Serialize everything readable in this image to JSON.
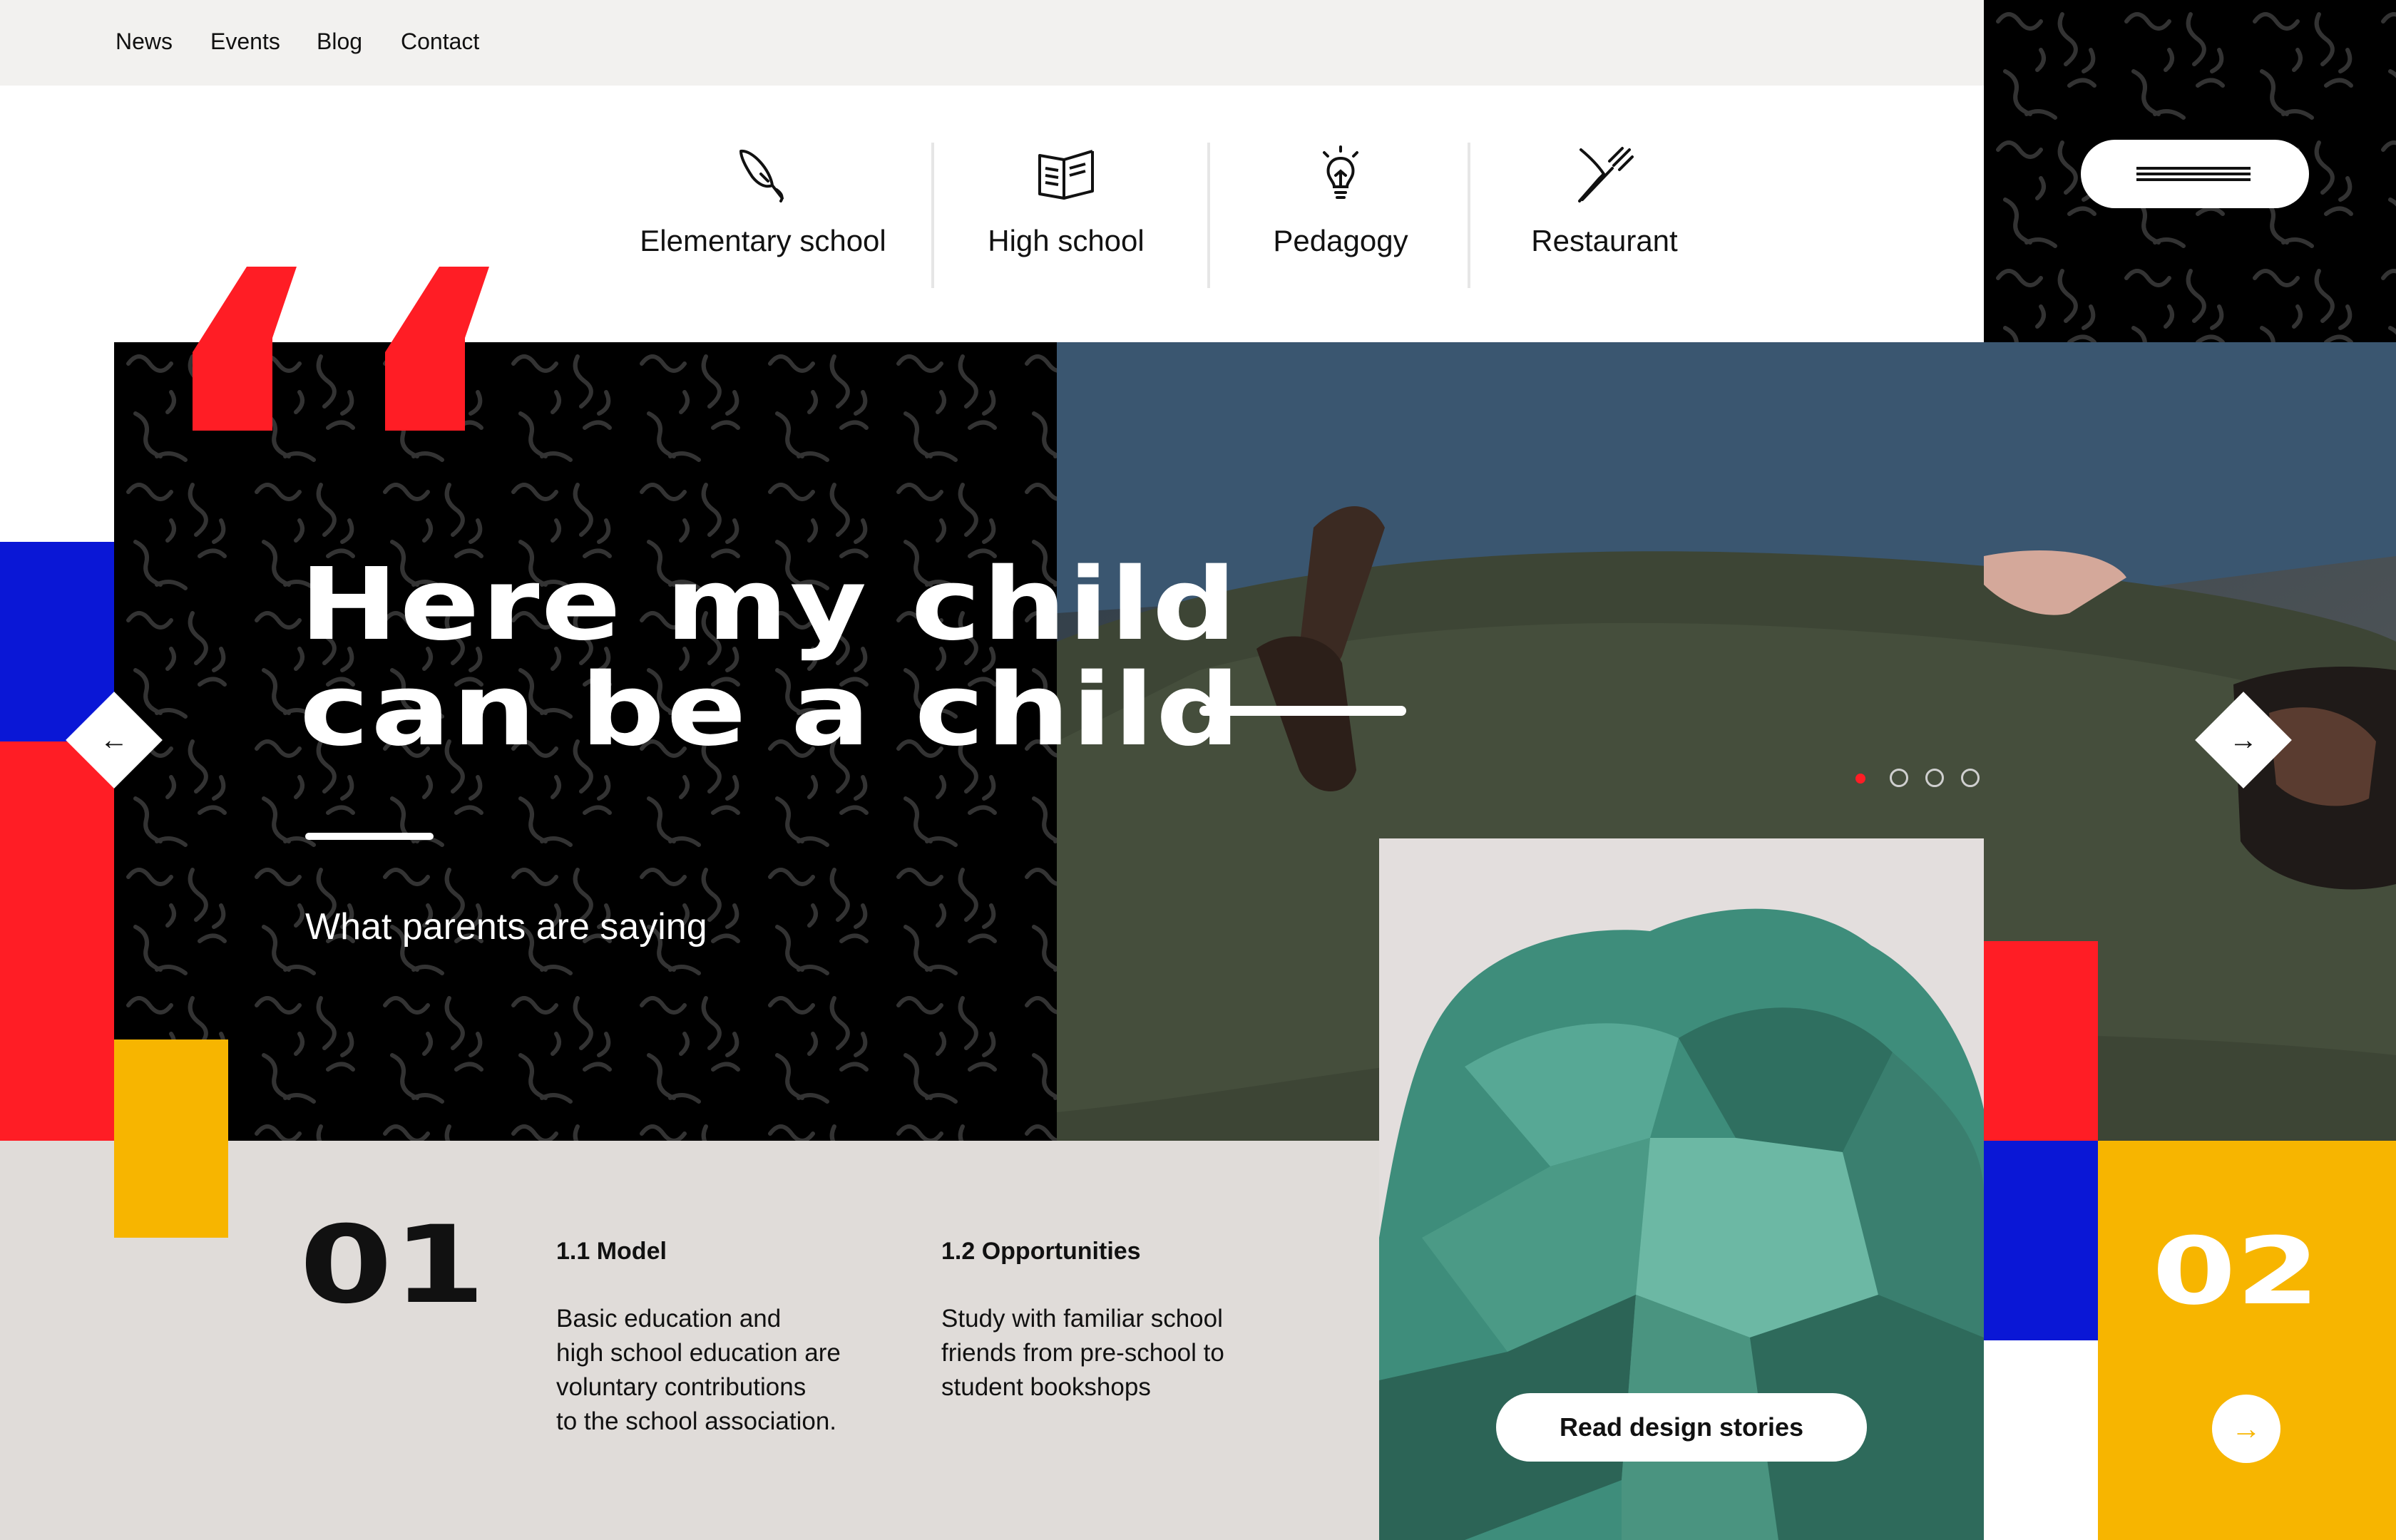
{
  "nav": {
    "items": [
      "News",
      "Events",
      "Blog",
      "Contact"
    ]
  },
  "categories": [
    {
      "label": "Elementary school",
      "icon": "paintbrush-icon"
    },
    {
      "label": "High school",
      "icon": "book-icon"
    },
    {
      "label": "Pedagogy",
      "icon": "lightbulb-icon"
    },
    {
      "label": "Restaurant",
      "icon": "utensils-icon"
    }
  ],
  "hero": {
    "headline_line1": "Here my child",
    "headline_line2": "can be a child",
    "subtitle": "What parents are saying"
  },
  "carousel": {
    "active_index": 0,
    "count": 4
  },
  "section1": {
    "number": "01",
    "col1": {
      "title": "1.1 Model",
      "text": "Basic education and\nhigh school education are\nvoluntary contributions\nto the school association."
    },
    "col2": {
      "title": "1.2 Opportunities",
      "text": "Study with familiar school\nfriends from pre-school to\nstudent bookshops"
    }
  },
  "cta": {
    "label": "Read design stories"
  },
  "section2": {
    "number": "02"
  },
  "colors": {
    "red": "#ff1d25",
    "blue": "#0a17d6",
    "yellow": "#f7b500",
    "black": "#000000",
    "beige": "#e0dcd9"
  }
}
